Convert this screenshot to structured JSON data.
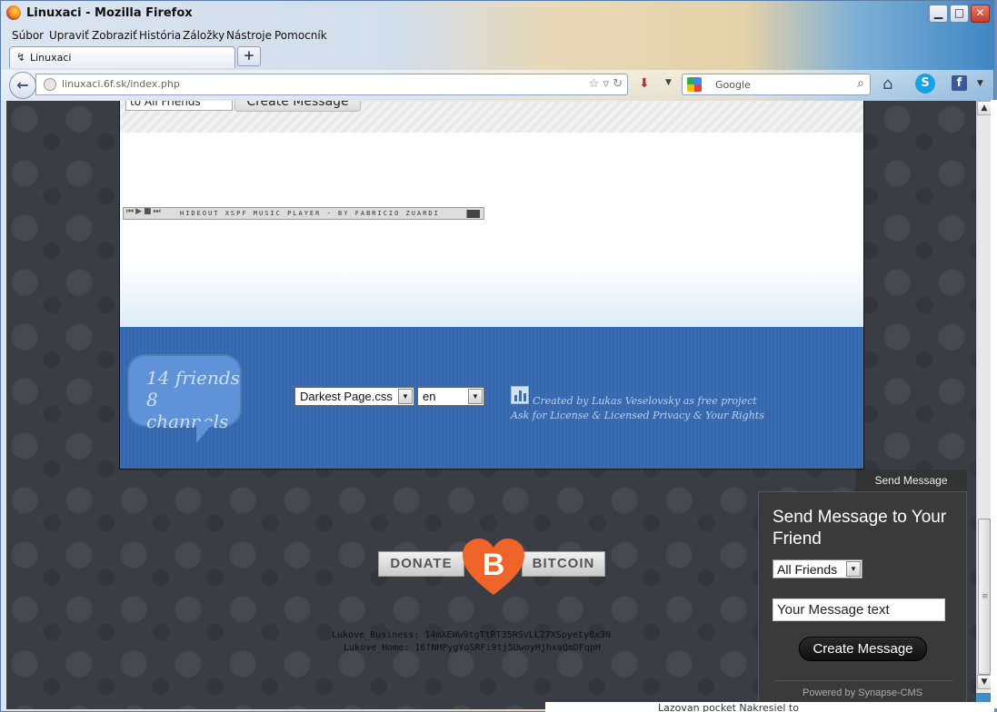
{
  "window": {
    "title": "Linuxaci - Mozilla Firefox",
    "minimize": "▁",
    "maximize": "□",
    "close": "✕"
  },
  "menubar": [
    "Súbor",
    "Upraviť",
    "Zobraziť",
    "História",
    "Záložky",
    "Nástroje",
    "Pomocník"
  ],
  "tabs": [
    {
      "label": "Linuxaci"
    }
  ],
  "newtab": "+",
  "navbar": {
    "url": "linuxaci.6f.sk/index.php",
    "search_placeholder": "Google"
  },
  "page": {
    "top_select": "to All Friends",
    "top_button": "Create Message",
    "player_title": "HIDEOUT XSPF MUSIC PLAYER - BY FABRICIO ZUARDI",
    "stats": {
      "friends": "14 friends",
      "channels": "8 channels"
    },
    "theme_select": "Darkest Page.css",
    "lang_select": "en",
    "credits_line1": "Created by Lukas Veselovsky as free project",
    "credits_line2": "Ask for License & Licensed  Privacy & Your Rights",
    "donate": {
      "left": "DONATE",
      "right": "BITCOIN",
      "symbol": "B"
    },
    "addresses": [
      "Lukove_Business: 14mXEWw9tgTtRT35RSvLL27XSpyety8x3N",
      "Lukove_Home: 16fNHPygYoSRFi9tj5UwoyHjhxaQmDFqpH"
    ]
  },
  "send_message": {
    "tab": "Send Message",
    "title": "Send Message to Your Friend",
    "recipient": "All Friends",
    "message_value": "Your Message text",
    "button": "Create Message",
    "powered_by": "Powered by Synapse-CMS"
  },
  "background_text": "Lazovan pocket Nakresiel to",
  "colors": {
    "footer": "#3b6db3",
    "heart": "#f0642a",
    "page_bg": "#3a3d44"
  }
}
